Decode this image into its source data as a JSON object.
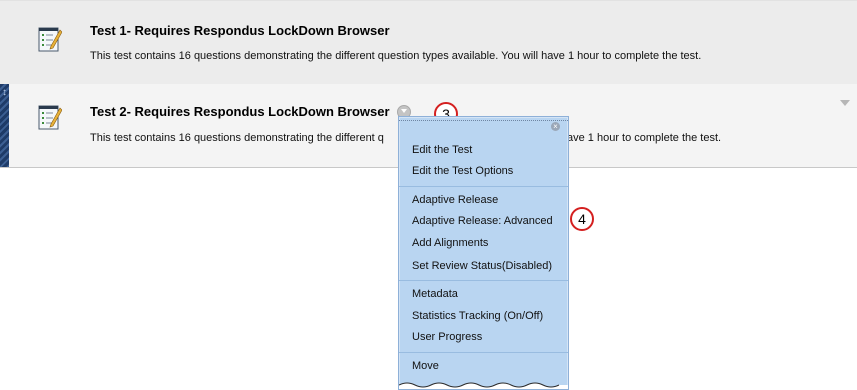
{
  "tests": [
    {
      "title": "Test 1- Requires Respondus LockDown Browser",
      "description": "This test contains 16 questions demonstrating the different question types available. You will have 1 hour to complete the test."
    },
    {
      "title": "Test 2- Requires Respondus LockDown Browser",
      "description_left": "This test contains 16 questions demonstrating the different q",
      "description_right": "ave 1 hour to complete the test."
    }
  ],
  "callouts": {
    "first": "3",
    "second": "4"
  },
  "menu": {
    "close_glyph": "×",
    "items": [
      "Edit the Test",
      "Edit the Test Options",
      "Adaptive Release",
      "Adaptive Release: Advanced",
      "Add Alignments",
      "Set Review Status(Disabled)",
      "Metadata",
      "Statistics Tracking (On/Off)",
      "User Progress",
      "Move"
    ]
  },
  "drag_glyph": "↕",
  "icons": [
    "test-icon",
    "context-menu-icon",
    "drag-handle-icon",
    "collapse-arrow-icon",
    "close-icon"
  ],
  "colors": {
    "menu_bg": "#b9d5f1",
    "callout_border": "#d41f1f",
    "drag_strip": "#1e3b68"
  }
}
